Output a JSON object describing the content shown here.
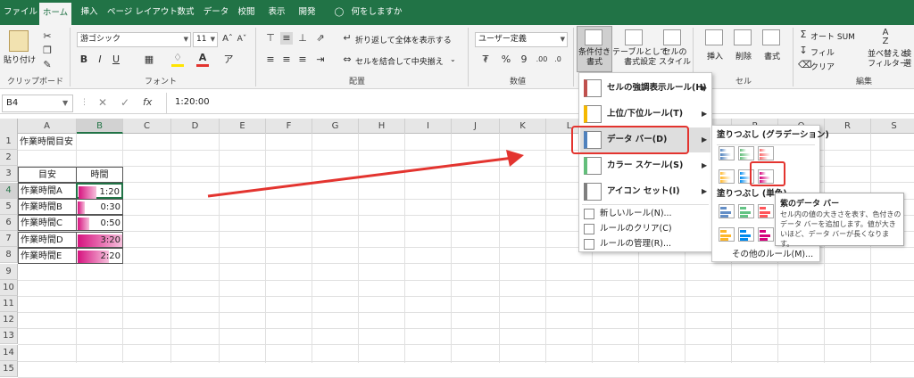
{
  "ribbon_tabs": [
    "ファイル",
    "ホーム",
    "挿入",
    "ページ レイアウト",
    "数式",
    "データ",
    "校閲",
    "表示",
    "開発"
  ],
  "tell_me": "何をしますか",
  "clipboard": {
    "paste": "貼り付け",
    "group": "クリップボード"
  },
  "font": {
    "name": "游ゴシック",
    "size": "11",
    "bold": "B",
    "italic": "I",
    "underline": "U",
    "group": "フォント"
  },
  "alignment": {
    "wrap": "折り返して全体を表示する",
    "merge": "セルを結合して中央揃え",
    "group": "配置"
  },
  "number": {
    "format": "ユーザー定義",
    "percent": "%",
    "comma": "9",
    "group": "数値"
  },
  "styles": {
    "cond_format": "条件付き\n書式",
    "table": "テーブルとして\n書式設定",
    "cell_style": "セルの\nスタイル"
  },
  "cells": {
    "insert": "挿入",
    "delete": "削除",
    "format": "書式",
    "group": "セル"
  },
  "editing": {
    "autosum": "オート SUM",
    "fill": "フィル",
    "clear": "クリア",
    "sort": "並べ替えと\nフィルター",
    "select": "検\n選",
    "group": "編集"
  },
  "formula_bar": {
    "name_box": "B4",
    "fx": "fx",
    "value": "1:20:00"
  },
  "columns": [
    "A",
    "B",
    "C",
    "D",
    "E",
    "F",
    "G",
    "H",
    "I",
    "J",
    "K",
    "L",
    "M",
    "N",
    "O",
    "P",
    "Q",
    "R",
    "S"
  ],
  "rows": [
    "1",
    "2",
    "3",
    "4",
    "5",
    "6",
    "7",
    "8",
    "9",
    "10",
    "11",
    "12",
    "13",
    "14",
    "15"
  ],
  "sheet": {
    "title": "作業時間目安",
    "header_a": "目安",
    "header_b": "時間",
    "tasks": [
      {
        "name": "作業時間A",
        "time": "1:20",
        "ratio": 0.4
      },
      {
        "name": "作業時間B",
        "time": "0:30",
        "ratio": 0.15
      },
      {
        "name": "作業時間C",
        "time": "0:50",
        "ratio": 0.25
      },
      {
        "name": "作業時間D",
        "time": "3:20",
        "ratio": 1.0
      },
      {
        "name": "作業時間E",
        "time": "2:20",
        "ratio": 0.7
      }
    ]
  },
  "cf_menu": {
    "items": [
      "セルの強調表示ルール(H)",
      "上位/下位ルール(T)",
      "データ バー(D)",
      "カラー スケール(S)",
      "アイコン セット(I)"
    ],
    "extra": [
      "新しいルール(N)...",
      "ルールのクリア(C)",
      "ルールの管理(R)..."
    ]
  },
  "databar_menu": {
    "gradient_header": "塗りつぶし (グラデーション)",
    "solid_header": "塗りつぶし (単色)",
    "more": "その他のルール(M)...",
    "gradient_colors": [
      "#4f81bd",
      "#63be7b",
      "#f8696b",
      "#ffb628",
      "#008aef",
      "#d6007b"
    ],
    "solid_colors": [
      "#638ec6",
      "#63c384",
      "#ff555a",
      "#ffb628",
      "#008aef",
      "#d6007b"
    ]
  },
  "tooltip": {
    "title": "紫のデータ バー",
    "body": "セル内の値の大きさを表す、色付きのデータ バーを追加します。値が大きいほど、データ バーが長くなります。"
  },
  "colors": {
    "accent": "#217346",
    "highlight": "#e3342f",
    "bar": "#d6137f"
  }
}
